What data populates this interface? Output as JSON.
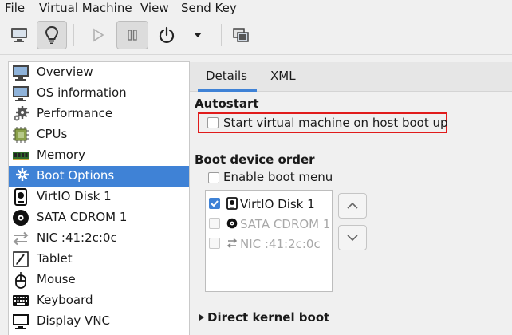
{
  "menubar": {
    "file": "File",
    "virtual_machine": "Virtual Machine",
    "view": "View",
    "send_key": "Send Key"
  },
  "toolbar": {
    "buttons": [
      "console-icon",
      "details-lightbulb-icon",
      "run-icon",
      "pause-icon",
      "power-icon",
      "power-dropdown-icon",
      "screenshot-icon"
    ]
  },
  "sidebar": {
    "items": [
      {
        "label": "Overview",
        "icon": "monitor-icon"
      },
      {
        "label": "OS information",
        "icon": "monitor-icon"
      },
      {
        "label": "Performance",
        "icon": "gears-icon"
      },
      {
        "label": "CPUs",
        "icon": "cpu-icon"
      },
      {
        "label": "Memory",
        "icon": "memory-icon"
      },
      {
        "label": "Boot Options",
        "icon": "gears-icon",
        "selected": true
      },
      {
        "label": "VirtIO Disk 1",
        "icon": "disk-icon"
      },
      {
        "label": "SATA CDROM 1",
        "icon": "cdrom-icon"
      },
      {
        "label": "NIC :41:2c:0c",
        "icon": "network-icon"
      },
      {
        "label": "Tablet",
        "icon": "tablet-icon"
      },
      {
        "label": "Mouse",
        "icon": "mouse-icon"
      },
      {
        "label": "Keyboard",
        "icon": "keyboard-icon"
      },
      {
        "label": "Display VNC",
        "icon": "display-icon"
      }
    ]
  },
  "tabs": {
    "details": "Details",
    "xml": "XML",
    "active": "Details"
  },
  "autostart": {
    "title": "Autostart",
    "checkbox_label": "Start virtual machine on host boot up",
    "checked": false
  },
  "boot_order": {
    "title": "Boot device order",
    "enable_menu_label": "Enable boot menu",
    "enable_menu_checked": false,
    "devices": [
      {
        "label": "VirtIO Disk 1",
        "checked": true,
        "enabled": true,
        "icon": "disk-icon"
      },
      {
        "label": "SATA CDROM 1",
        "checked": false,
        "enabled": false,
        "icon": "cdrom-icon"
      },
      {
        "label": "NIC :41:2c:0c",
        "checked": false,
        "enabled": false,
        "icon": "network-icon"
      }
    ]
  },
  "direct_kernel_boot": {
    "title": "Direct kernel boot",
    "expanded": false
  },
  "colors": {
    "accent": "#3f82d6",
    "highlight_border": "#e01b1b"
  }
}
